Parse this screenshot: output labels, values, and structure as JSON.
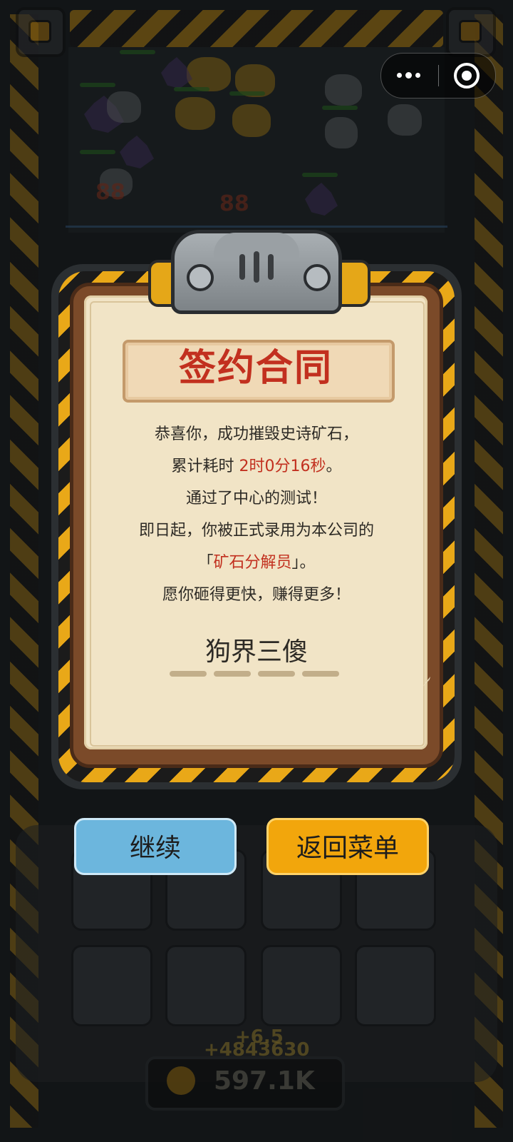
{
  "game_background": {
    "damage_numbers": [
      "88",
      "88"
    ],
    "gain_text": "+4843630",
    "gain_text_2": "+6.5",
    "money": "597.1K"
  },
  "capsule": {
    "more_icon": "ellipsis-icon",
    "close_icon": "target-circle-icon"
  },
  "contract": {
    "title": "签约合同",
    "line1": "恭喜你，成功摧毁史诗矿石，",
    "line2_prefix": "累计耗时 ",
    "line2_time": "2时0分16秒",
    "line2_suffix": "。",
    "line3": "通过了中心的测试！",
    "line4": "即日起，你被正式录用为本公司的",
    "line5_open": "「",
    "line5_role": "矿石分解员",
    "line5_close": "」。",
    "line6": "愿你砸得更快，赚得更多！",
    "signature": "狗界三傻"
  },
  "buttons": {
    "continue_label": "继续",
    "menu_label": "返回菜单"
  },
  "colors": {
    "highlight": "#c2301f",
    "continue_button": "#6cb6dd",
    "menu_button": "#f2a60c",
    "paper": "#f1e4c6"
  }
}
